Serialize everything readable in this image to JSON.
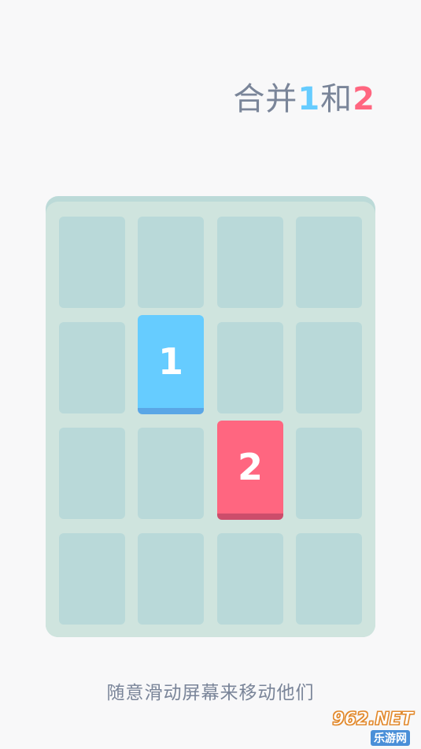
{
  "title": {
    "prefix": "合并",
    "num1": "1",
    "middle": "和",
    "num2": "2",
    "text_color": "#7a8599",
    "num1_color": "#66ccff",
    "num2_color": "#ff6680"
  },
  "board": {
    "rows": 4,
    "cols": 4,
    "tiles": [
      {
        "value": "1",
        "row": 2,
        "col": 2,
        "color": "#66ccff"
      },
      {
        "value": "2",
        "row": 3,
        "col": 3,
        "color": "#ff6680"
      }
    ],
    "background_color": "#cfe4de",
    "empty_cell_color": "#b9d9d9"
  },
  "caption": "随意滑动屏幕来移动他们",
  "watermark": {
    "brand": "962.NET",
    "site": "乐游网"
  }
}
